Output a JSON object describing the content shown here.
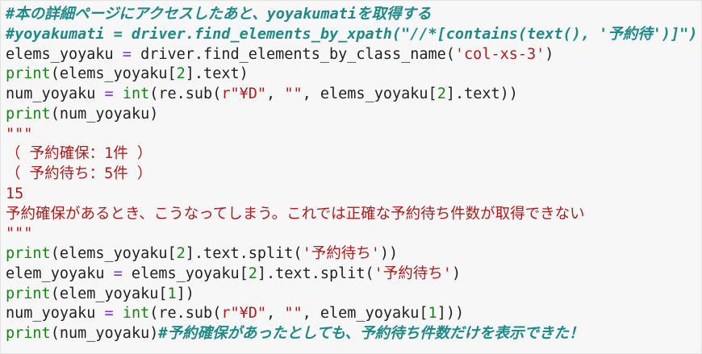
{
  "code_editor": {
    "lines": [
      [
        {
          "t": "#本の詳細ページにアクセスしたあと、yoyakumatiを取得する",
          "c": "comment"
        }
      ],
      [
        {
          "t": "#yoyakumati = driver.find_elements_by_xpath(\"//*[contains(text(), '予約待')]\")",
          "c": "comment"
        }
      ],
      [
        {
          "t": "elems_yoyaku ",
          "c": "plain"
        },
        {
          "t": "=",
          "c": "op"
        },
        {
          "t": " driver.find_elements_by_class_name(",
          "c": "plain"
        },
        {
          "t": "'col-xs-3'",
          "c": "string"
        },
        {
          "t": ")",
          "c": "plain"
        }
      ],
      [
        {
          "t": "print",
          "c": "builtin"
        },
        {
          "t": "(elems_yoyaku[",
          "c": "plain"
        },
        {
          "t": "2",
          "c": "number"
        },
        {
          "t": "].text)",
          "c": "plain"
        }
      ],
      [
        {
          "t": "num_yoyaku ",
          "c": "plain"
        },
        {
          "t": "=",
          "c": "op"
        },
        {
          "t": " ",
          "c": "plain"
        },
        {
          "t": "int",
          "c": "builtin"
        },
        {
          "t": "(re.sub(",
          "c": "plain"
        },
        {
          "t": "r\"¥D\"",
          "c": "string"
        },
        {
          "t": ", ",
          "c": "plain"
        },
        {
          "t": "\"\"",
          "c": "string"
        },
        {
          "t": ", elems_yoyaku[",
          "c": "plain"
        },
        {
          "t": "2",
          "c": "number"
        },
        {
          "t": "].text))",
          "c": "plain"
        }
      ],
      [
        {
          "t": "print",
          "c": "builtin"
        },
        {
          "t": "(num_yoyaku)",
          "c": "plain"
        }
      ],
      [
        {
          "t": "\"\"\"",
          "c": "string"
        }
      ],
      [
        {
          "t": "（ 予約確保：1件 ）",
          "c": "string"
        }
      ],
      [
        {
          "t": "（ 予約待ち：5件 ）",
          "c": "string"
        }
      ],
      [
        {
          "t": "15",
          "c": "string"
        }
      ],
      [
        {
          "t": "予約確保があるとき、こうなってしまう。これでは正確な予約待ち件数が取得できない",
          "c": "string"
        }
      ],
      [
        {
          "t": "\"\"\"",
          "c": "string"
        }
      ],
      [
        {
          "t": "print",
          "c": "builtin"
        },
        {
          "t": "(elems_yoyaku[",
          "c": "plain"
        },
        {
          "t": "2",
          "c": "number"
        },
        {
          "t": "].text.split(",
          "c": "plain"
        },
        {
          "t": "'予約待ち'",
          "c": "string"
        },
        {
          "t": "))",
          "c": "plain"
        }
      ],
      [
        {
          "t": "elem_yoyaku ",
          "c": "plain"
        },
        {
          "t": "=",
          "c": "op"
        },
        {
          "t": " elems_yoyaku[",
          "c": "plain"
        },
        {
          "t": "2",
          "c": "number"
        },
        {
          "t": "].text.split(",
          "c": "plain"
        },
        {
          "t": "'予約待ち'",
          "c": "string"
        },
        {
          "t": ")",
          "c": "plain"
        }
      ],
      [
        {
          "t": "print",
          "c": "builtin"
        },
        {
          "t": "(elem_yoyaku[",
          "c": "plain"
        },
        {
          "t": "1",
          "c": "number"
        },
        {
          "t": "])",
          "c": "plain"
        }
      ],
      [
        {
          "t": "num_yoyaku ",
          "c": "plain"
        },
        {
          "t": "=",
          "c": "op"
        },
        {
          "t": " ",
          "c": "plain"
        },
        {
          "t": "int",
          "c": "builtin"
        },
        {
          "t": "(re.sub(",
          "c": "plain"
        },
        {
          "t": "r\"¥D\"",
          "c": "string"
        },
        {
          "t": ", ",
          "c": "plain"
        },
        {
          "t": "\"\"",
          "c": "string"
        },
        {
          "t": ", elem_yoyaku[",
          "c": "plain"
        },
        {
          "t": "1",
          "c": "number"
        },
        {
          "t": "]))",
          "c": "plain"
        }
      ],
      [
        {
          "t": "print",
          "c": "builtin"
        },
        {
          "t": "(num_yoyaku)",
          "c": "plain"
        },
        {
          "t": "#予約確保があったとしても、予約待ち件数だけを表示できた！",
          "c": "comment"
        }
      ]
    ]
  },
  "colors": {
    "background": "#f7f7f7",
    "plain": "#222222",
    "comment": "#1f8a8a",
    "builtin": "#0f8a0f",
    "string": "#b21c1c",
    "number": "#118811",
    "operator": "#8a2be2"
  }
}
